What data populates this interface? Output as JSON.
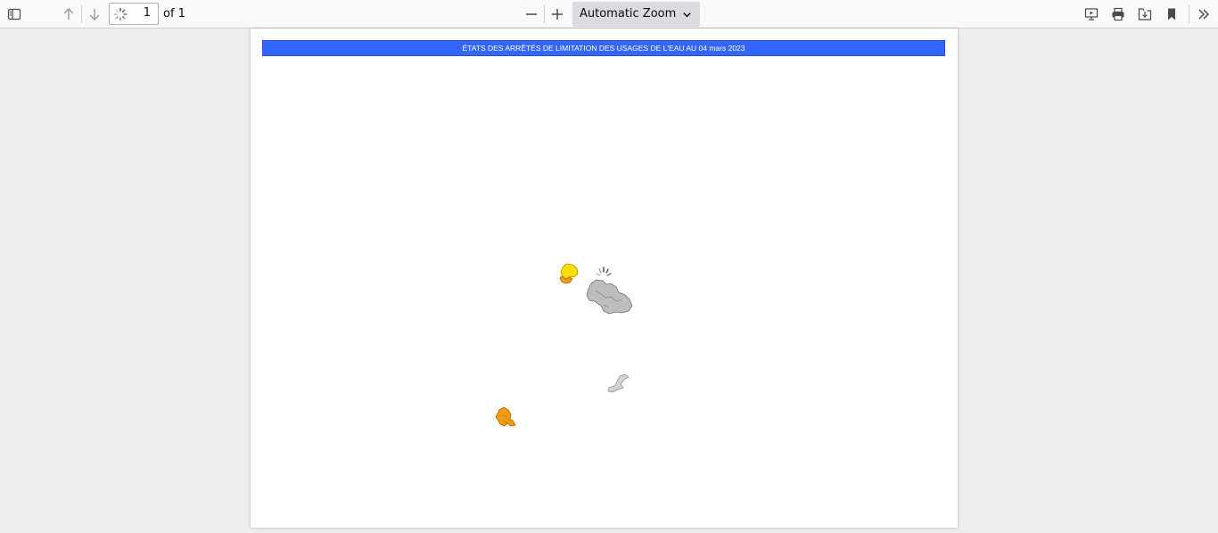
{
  "toolbar": {
    "page_number": "1",
    "page_of": "of 1",
    "zoom_value": "Automatic Zoom",
    "icons": [
      "sidebar-toggle-icon",
      "arrow-up-icon",
      "arrow-down-icon",
      "loading-spinner-icon",
      "zoom-out-icon",
      "zoom-in-icon",
      "chevron-down-icon",
      "presentation-icon",
      "print-icon",
      "download-icon",
      "bookmark-icon",
      "double-chevron-right-icon"
    ]
  },
  "document": {
    "banner_title": "ÉTATS DES ARRÊTÉS DE LIMITATION DES USAGES DE L'EAU AU 04 mars 2023"
  },
  "colors": {
    "banner": "#3366ff",
    "alert_yellow": "#ffdd00",
    "alert_orange": "#f39c12",
    "no_restriction_grey": "#bdbdbd"
  }
}
